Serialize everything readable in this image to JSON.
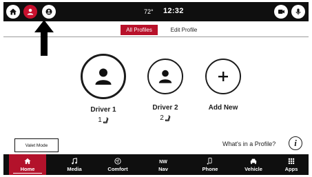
{
  "status_bar": {
    "temperature": "72°",
    "time": "12:32"
  },
  "tabs": [
    {
      "label": "All Profiles",
      "active": true
    },
    {
      "label": "Edit Profile",
      "active": false
    }
  ],
  "profiles": [
    {
      "name": "Driver 1",
      "number": "1"
    },
    {
      "name": "Driver 2",
      "number": "2"
    },
    {
      "name": "Add New"
    }
  ],
  "valet_mode": {
    "label": "Valet Mode"
  },
  "help": {
    "label": "What's in a Profile?",
    "icon_text": "i"
  },
  "nav": [
    {
      "label": "Home",
      "icon": "home-icon",
      "active": true
    },
    {
      "label": "Media",
      "icon": "music-note-icon"
    },
    {
      "label": "Comfort",
      "icon": "fan-icon"
    },
    {
      "label": "Nav",
      "icon": "compass-icon",
      "icon_text": "NW"
    },
    {
      "label": "Phone",
      "icon": "phone-icon"
    },
    {
      "label": "Vehicle",
      "icon": "car-icon"
    },
    {
      "label": "Apps",
      "icon": "apps-grid-icon"
    }
  ],
  "colors": {
    "accent": "#b8112a",
    "bar_background": "#0f0f0f"
  }
}
